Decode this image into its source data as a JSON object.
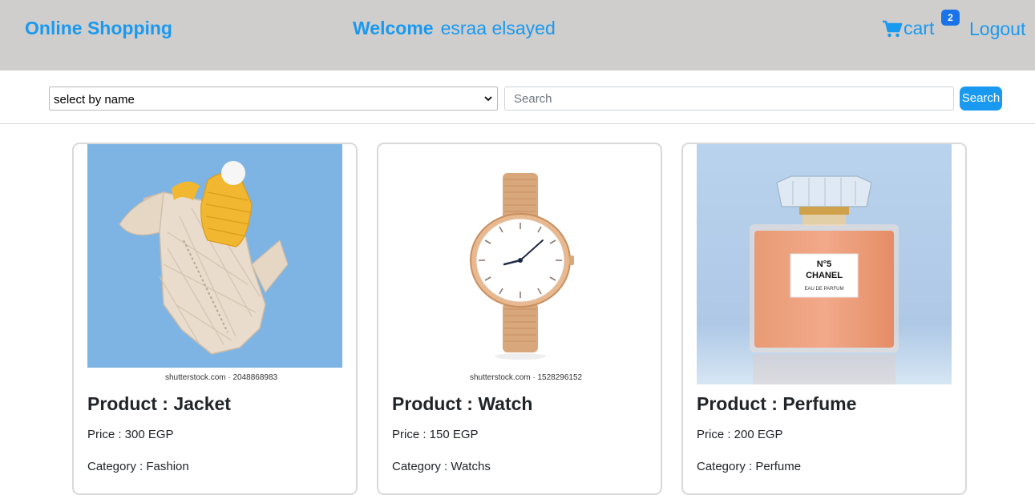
{
  "navbar": {
    "brand": "Online Shopping",
    "welcome_label": "Welcome",
    "username": "esraa elsayed",
    "cart_label": "cart",
    "cart_count": "2",
    "logout_label": "Logout"
  },
  "filters": {
    "select_value": "select by name",
    "search_placeholder": "Search",
    "search_button": "Search"
  },
  "products": [
    {
      "title": "Product : Jacket",
      "price": "Price : 300 EGP",
      "category": "Category : Fashion",
      "watermark": "shutterstock.com · 2048868983"
    },
    {
      "title": "Product : Watch",
      "price": "Price : 150 EGP",
      "category": "Category : Watchs",
      "watermark": "shutterstock.com · 1528296152"
    },
    {
      "title": "Product : Perfume",
      "price": "Price : 200 EGP",
      "category": "Category : Perfume",
      "label_line1": "N°5",
      "label_line2": "CHANEL",
      "label_line3": "EAU DE PARFUM"
    }
  ],
  "colors": {
    "accent": "#1a99f0",
    "navbar_bg": "#cfcecd",
    "badge_bg": "#1a73e8"
  }
}
